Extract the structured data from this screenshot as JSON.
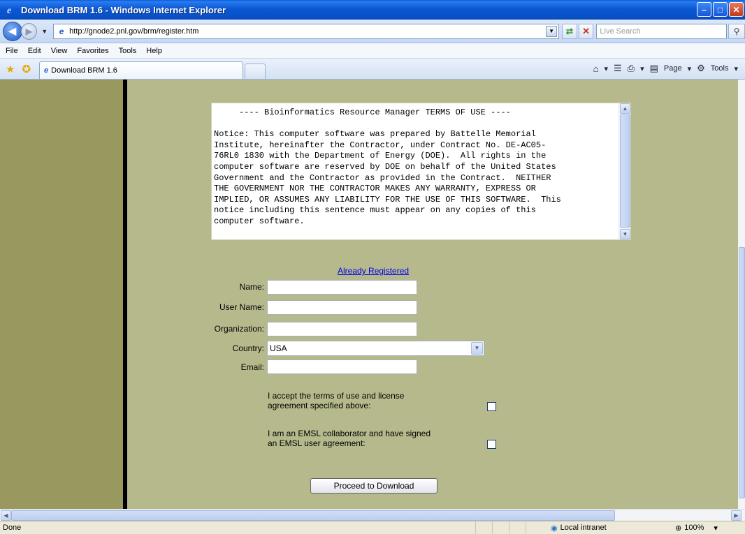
{
  "window": {
    "title": "Download BRM 1.6 - Windows Internet Explorer"
  },
  "address": {
    "url": "http://gnode2.pnl.gov/brm/register.htm",
    "search_placeholder": "Live Search"
  },
  "menu": {
    "items": [
      "File",
      "Edit",
      "View",
      "Favorites",
      "Tools",
      "Help"
    ]
  },
  "tabs": {
    "active_label": "Download BRM 1.6",
    "page_label": "Page",
    "tools_label": "Tools"
  },
  "terms": {
    "text": "     ---- Bioinformatics Resource Manager TERMS OF USE ----\n\nNotice: This computer software was prepared by Battelle Memorial\nInstitute, hereinafter the Contractor, under Contract No. DE-AC05-\n76RL0 1830 with the Department of Energy (DOE).  All rights in the\ncomputer software are reserved by DOE on behalf of the United States\nGovernment and the Contractor as provided in the Contract.  NEITHER\nTHE GOVERNMENT NOR THE CONTRACTOR MAKES ANY WARRANTY, EXPRESS OR\nIMPLIED, OR ASSUMES ANY LIABILITY FOR THE USE OF THIS SOFTWARE.  This\nnotice including this sentence must appear on any copies of this\ncomputer software."
  },
  "form": {
    "already_registered": "Already Registered",
    "name_label": "Name:",
    "username_label": "User Name:",
    "organization_label": "Organization:",
    "country_label": "Country:",
    "country_value": "USA",
    "email_label": "Email:",
    "accept_terms": "I accept the terms of use and license agreement specified above:",
    "emsl_collab": "I am an EMSL collaborator and have signed an EMSL user agreement:",
    "proceed_button": "Proceed to Download"
  },
  "status": {
    "text": "Done",
    "zone": "Local intranet",
    "zoom": "100%"
  },
  "colors": {
    "page_bg": "#b5b98b",
    "left_column": "#98985f",
    "title_bar": "#0b58d3"
  }
}
